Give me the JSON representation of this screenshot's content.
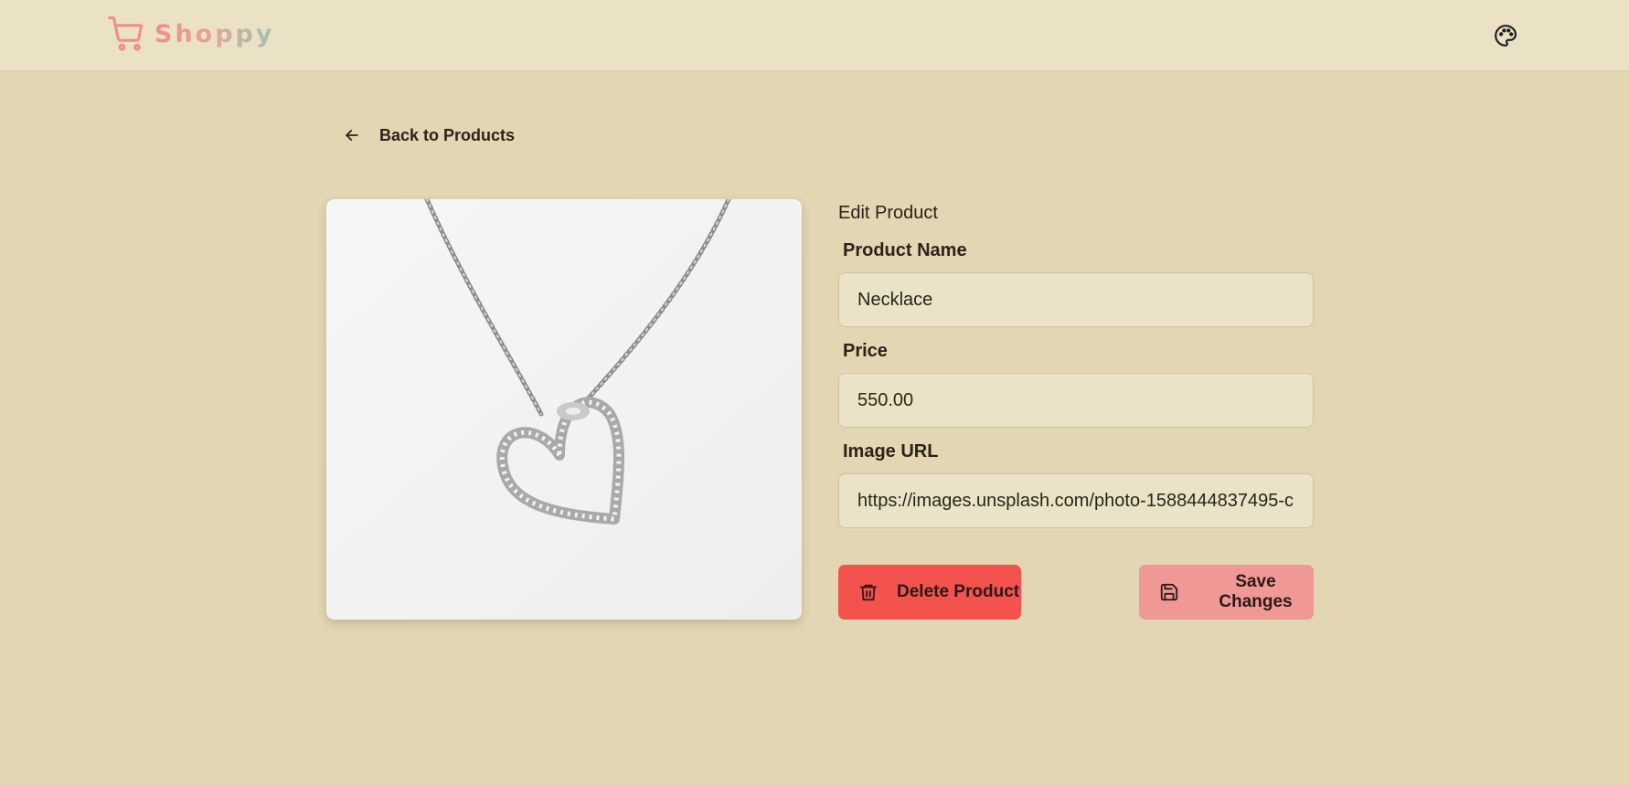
{
  "brand": {
    "name": "Shoppy",
    "logo_icon": "shopping-cart-icon"
  },
  "navbar": {
    "theme_icon": "palette-icon"
  },
  "back_link": {
    "label": "Back to Products",
    "icon": "arrow-left-icon"
  },
  "product_image": {
    "description_icon": "necklace-photo"
  },
  "form": {
    "title": "Edit Product",
    "name_label": "Product Name",
    "name_value": "Necklace",
    "price_label": "Price",
    "price_value": "550.00",
    "image_label": "Image URL",
    "image_value": "https://images.unsplash.com/photo-1588444837495-c"
  },
  "actions": {
    "delete_label": "Delete Product",
    "delete_icon": "trash-icon",
    "save_label": "Save Changes",
    "save_icon": "floppy-disk-icon"
  },
  "colors": {
    "page_bg": "#e3d6b2",
    "navbar_bg": "#ebe2c6",
    "delete_button": "#f4524c",
    "save_button": "#ef9895",
    "brand_start": "#ef8f88",
    "brand_end": "#9fc4b1"
  }
}
